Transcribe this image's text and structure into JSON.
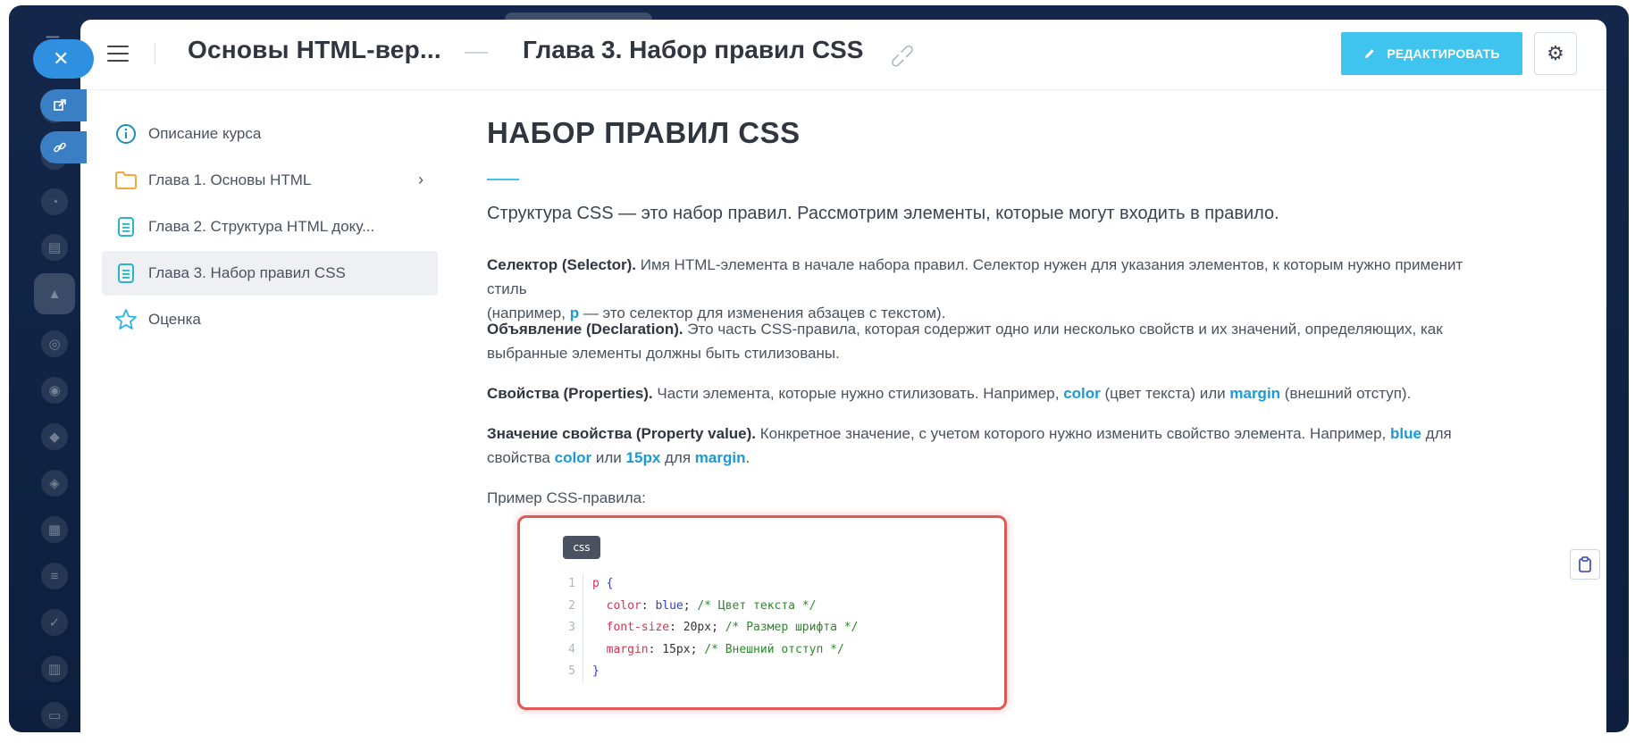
{
  "header": {
    "course_title": "Основы HTML-вер...",
    "chapter_title": "Глава 3. Набор правил CSS",
    "edit_label": "РЕДАКТИРОВАТЬ"
  },
  "nav": {
    "items": [
      {
        "label": "Описание курса",
        "icon": "info-icon"
      },
      {
        "label": "Глава 1. Основы HTML",
        "icon": "folder-icon"
      },
      {
        "label": "Глава 2. Структура HTML доку...",
        "icon": "document-icon"
      },
      {
        "label": "Глава 3. Набор правил CSS",
        "icon": "document-icon",
        "active": true
      },
      {
        "label": "Оценка",
        "icon": "star-icon"
      }
    ]
  },
  "content": {
    "heading": "НАБОР ПРАВИЛ CSS",
    "lead": "Структура CSS — это набор правил. Рассмотрим элементы, которые могут входить в правило.",
    "selector": {
      "term": "Селектор (Selector).",
      "text1": " Имя HTML-элемента в начале набора правил. Селектор нужен для указания элементов, к которым нужно применит стиль",
      "text2": "(например, ",
      "kw": "p",
      "text3": " — это селектор для изменения абзацев с текстом)."
    },
    "declaration": {
      "term": "Объявление (Declaration).",
      "text1": " Это часть CSS-правила, которая содержит одно или несколько свойств и их значений, определяющих, как",
      "text2": "выбранные элементы должны быть стилизованы."
    },
    "properties": {
      "term": "Свойства (Properties).",
      "text1": " Части элемента, которые нужно стилизовать. Например, ",
      "kw1": "color",
      "text2": " (цвет текста) или ",
      "kw2": "margin",
      "text3": " (внешний отступ)."
    },
    "value": {
      "term": "Значение свойства (Property value).",
      "text1": " Конкретное значение, с учетом которого нужно изменить свойство элемента. Например, ",
      "kw1": "blue",
      "text2": " для",
      "text3": "свойства ",
      "kw2": "color",
      "text4": " или ",
      "kw3": "15px",
      "text5": " для ",
      "kw4": "margin",
      "text6": "."
    },
    "example_label": "Пример CSS-правила:"
  },
  "code": {
    "lang": "css",
    "line_numbers": [
      "1",
      "2",
      "3",
      "4",
      "5"
    ],
    "l1_sel": "p",
    "l1_brace": " {",
    "l2_prop": "  color",
    "l2_colon": ": ",
    "l2_val": "blue",
    "l2_semi": "; ",
    "l2_com": "/* Цвет текста */",
    "l3_prop": "  font-size",
    "l3_colon": ": ",
    "l3_val": "20px",
    "l3_semi": "; ",
    "l3_com": "/* Размер шрифта */",
    "l4_prop": "  margin",
    "l4_colon": ": ",
    "l4_val": "15px",
    "l4_semi": "; ",
    "l4_com": "/* Внешний отступ */",
    "l5_brace": "}"
  },
  "colors": {
    "accent": "#3fc4ef",
    "keyword": "#1a9ad6",
    "highlight_border": "#e05858",
    "app_background": "#14274a"
  }
}
